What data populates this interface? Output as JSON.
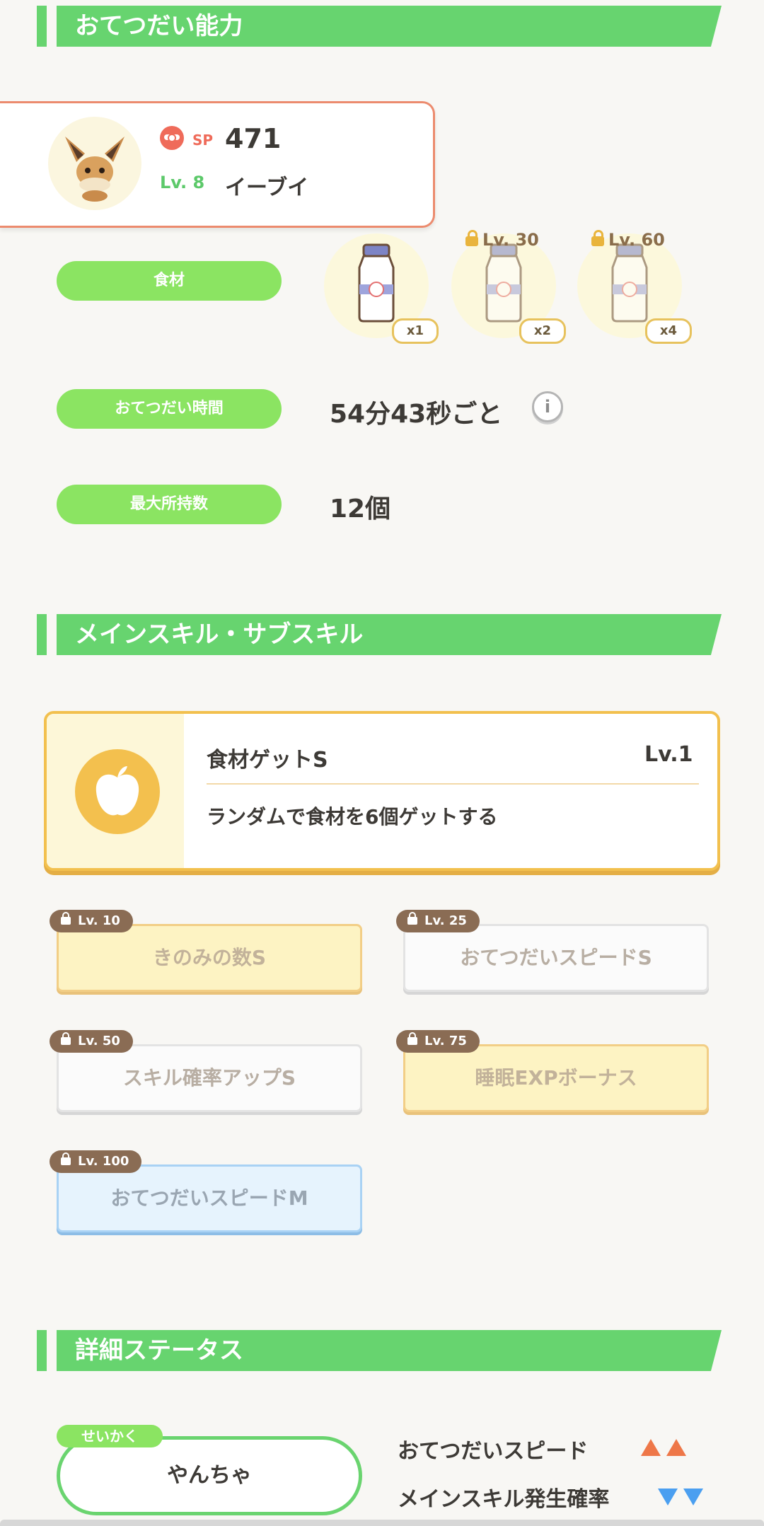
{
  "sections": {
    "help_ability": "おてつだい能力",
    "skills": "メインスキル・サブスキル",
    "details": "詳細ステータス"
  },
  "pokemon": {
    "sp_label": "SP",
    "sp_value": "471",
    "level": "Lv. 8",
    "name": "イーブイ"
  },
  "help": {
    "ingredients_label": "食材",
    "ingredients": [
      {
        "qty": "x1",
        "lock": ""
      },
      {
        "qty": "x2",
        "lock": "Lv. 30"
      },
      {
        "qty": "x4",
        "lock": "Lv. 60"
      }
    ],
    "time_label": "おてつだい時間",
    "time_value": "54分43秒ごと",
    "max_label": "最大所持数",
    "max_value": "12個"
  },
  "main_skill": {
    "name": "食材ゲットS",
    "level": "Lv.1",
    "description": "ランダムで食材を6個ゲットする"
  },
  "sub_skills": [
    {
      "lv": "Lv. 10",
      "name": "きのみの数S",
      "color": "yellow"
    },
    {
      "lv": "Lv. 25",
      "name": "おてつだいスピードS",
      "color": "white"
    },
    {
      "lv": "Lv. 50",
      "name": "スキル確率アップS",
      "color": "white"
    },
    {
      "lv": "Lv. 75",
      "name": "睡眠EXPボーナス",
      "color": "yellow"
    },
    {
      "lv": "Lv. 100",
      "name": "おてつだいスピードM",
      "color": "blue"
    }
  ],
  "details": {
    "nature_tag": "せいかく",
    "nature": "やんちゃ",
    "up_stat": "おてつだいスピード",
    "down_stat": "メインスキル発生確率"
  }
}
